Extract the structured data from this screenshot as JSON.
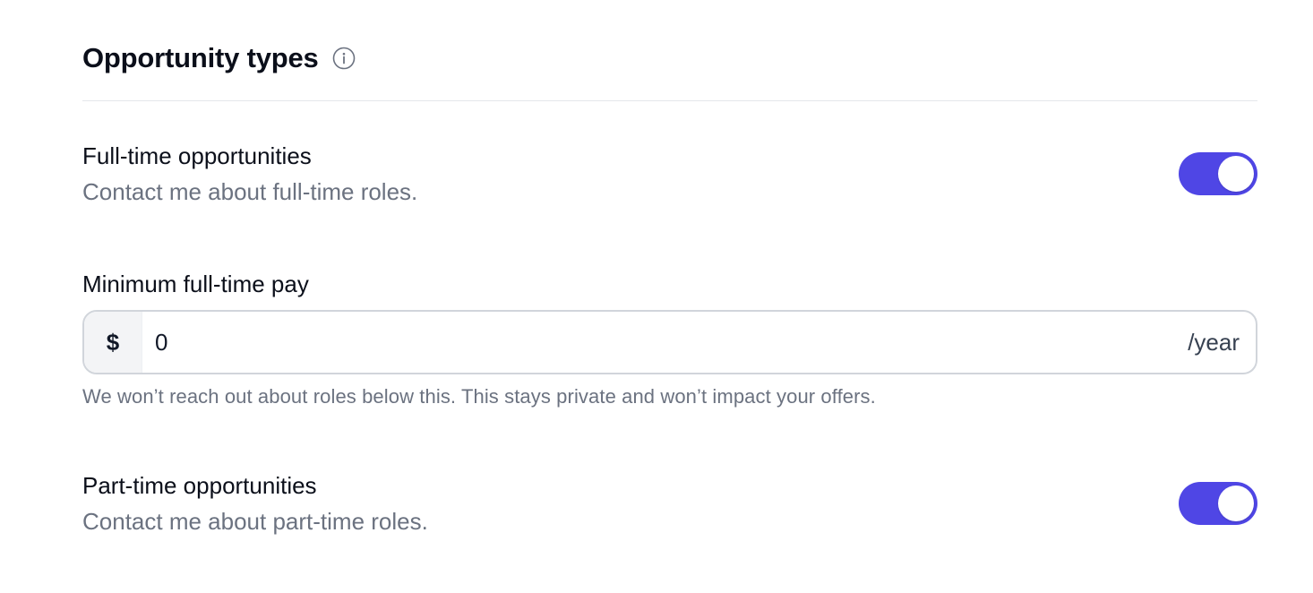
{
  "section": {
    "title": "Opportunity types"
  },
  "full_time": {
    "label": "Full-time opportunities",
    "description": "Contact me about full-time roles.",
    "enabled": true
  },
  "min_pay": {
    "label": "Minimum full-time pay",
    "prefix": "$",
    "value": "0",
    "suffix": "/year",
    "help": "We won’t reach out about roles below this. This stays private and won’t impact your offers."
  },
  "part_time": {
    "label": "Part-time opportunities",
    "description": "Contact me about part-time roles.",
    "enabled": true
  },
  "colors": {
    "accent": "#4f46e5",
    "muted_text": "#6b7280"
  },
  "icons": {
    "info": "info-icon"
  }
}
